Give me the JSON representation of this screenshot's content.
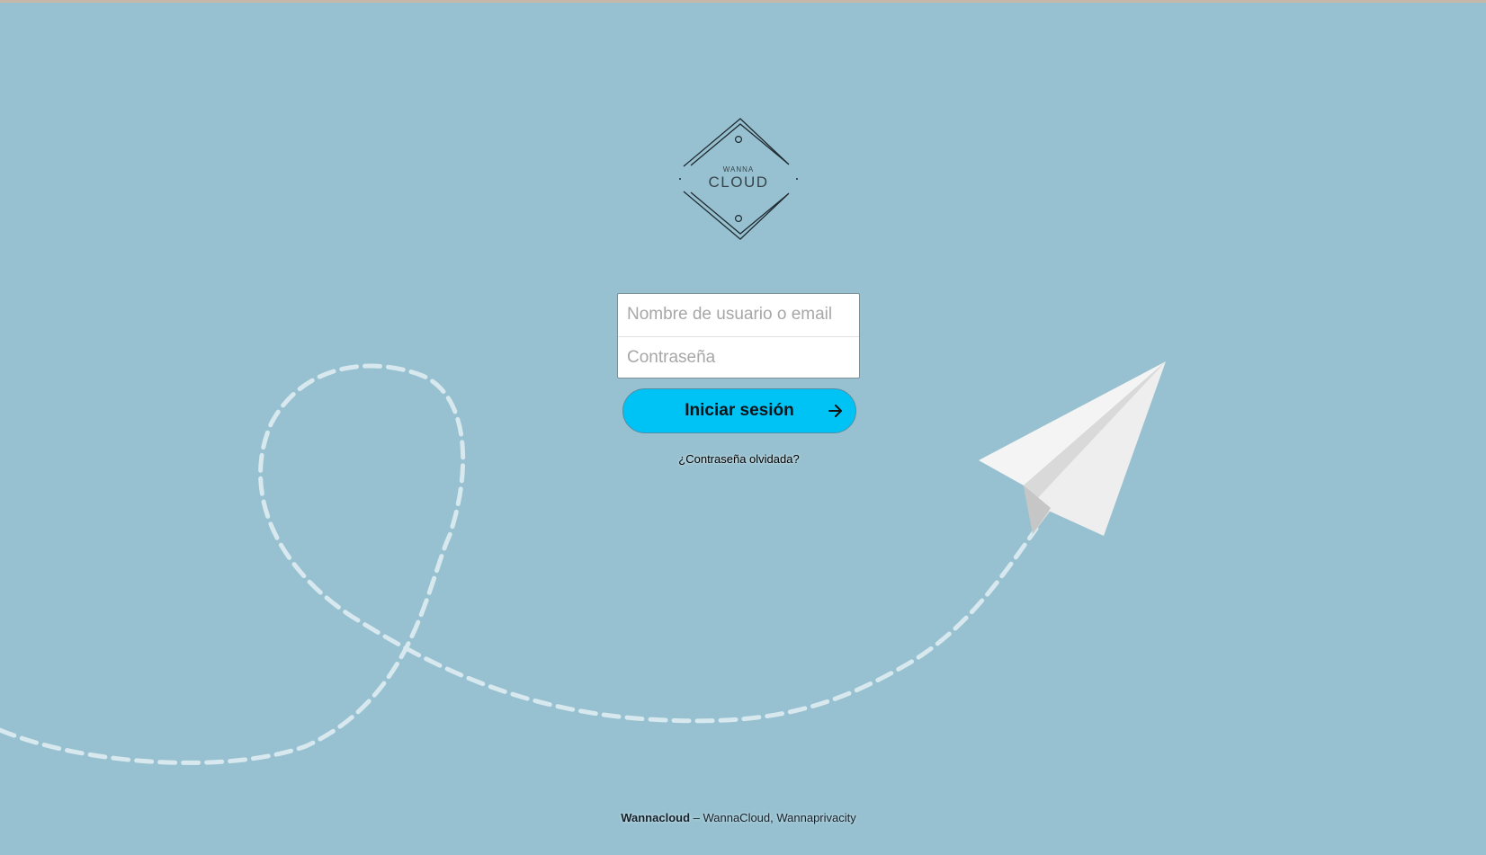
{
  "logo": {
    "top_text": "WANNA",
    "main_text": "CLOUD"
  },
  "login": {
    "username_placeholder": "Nombre de usuario o email",
    "password_placeholder": "Contraseña",
    "submit_label": "Iniciar sesión",
    "forgot_password": "¿Contraseña olvidada?"
  },
  "footer": {
    "brand": "Wannacloud",
    "tagline": " – WannaCloud, Wannaprivacity"
  },
  "icons": {
    "logo": "diamond-logo-icon",
    "submit": "arrow-right-icon",
    "background": "paper-plane-icon"
  },
  "colors": {
    "background": "#97c1d0",
    "button": "#00c3f5",
    "dash_trail": "#d7e8ee",
    "plane": "#eeeeee"
  }
}
